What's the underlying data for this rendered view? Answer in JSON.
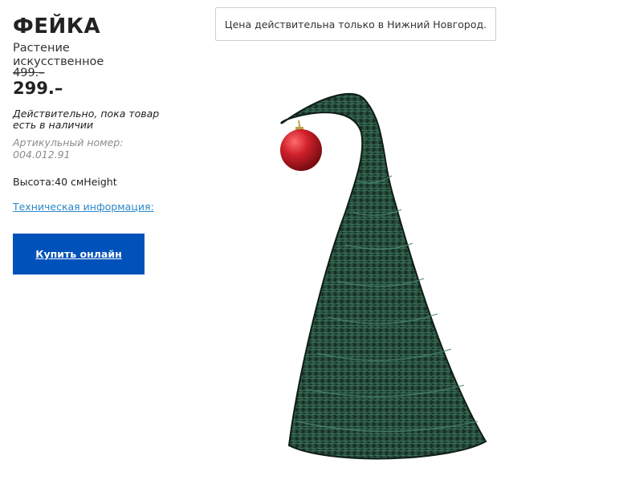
{
  "product": {
    "name": "ФЕЙКА",
    "type": "Растение искусственное",
    "old_price": "499.–",
    "new_price": "299.–",
    "availability": "Действительно, пока товар есть в наличии",
    "article": "Артикульный номер: 004.012.91",
    "height": "Высота:40 смHeight",
    "tech_info_link": "Техническая информация:",
    "buy_button": "Купить онлайн"
  },
  "notice": {
    "text": "Цена действительна только в Нижний Новгород."
  },
  "image": {
    "subject": "artificial-christmas-tree-with-red-bauble"
  },
  "colors": {
    "button_bg": "#0051ba",
    "link": "#2a87c9",
    "tree": "#1f3f33",
    "bauble": "#d0212b"
  }
}
